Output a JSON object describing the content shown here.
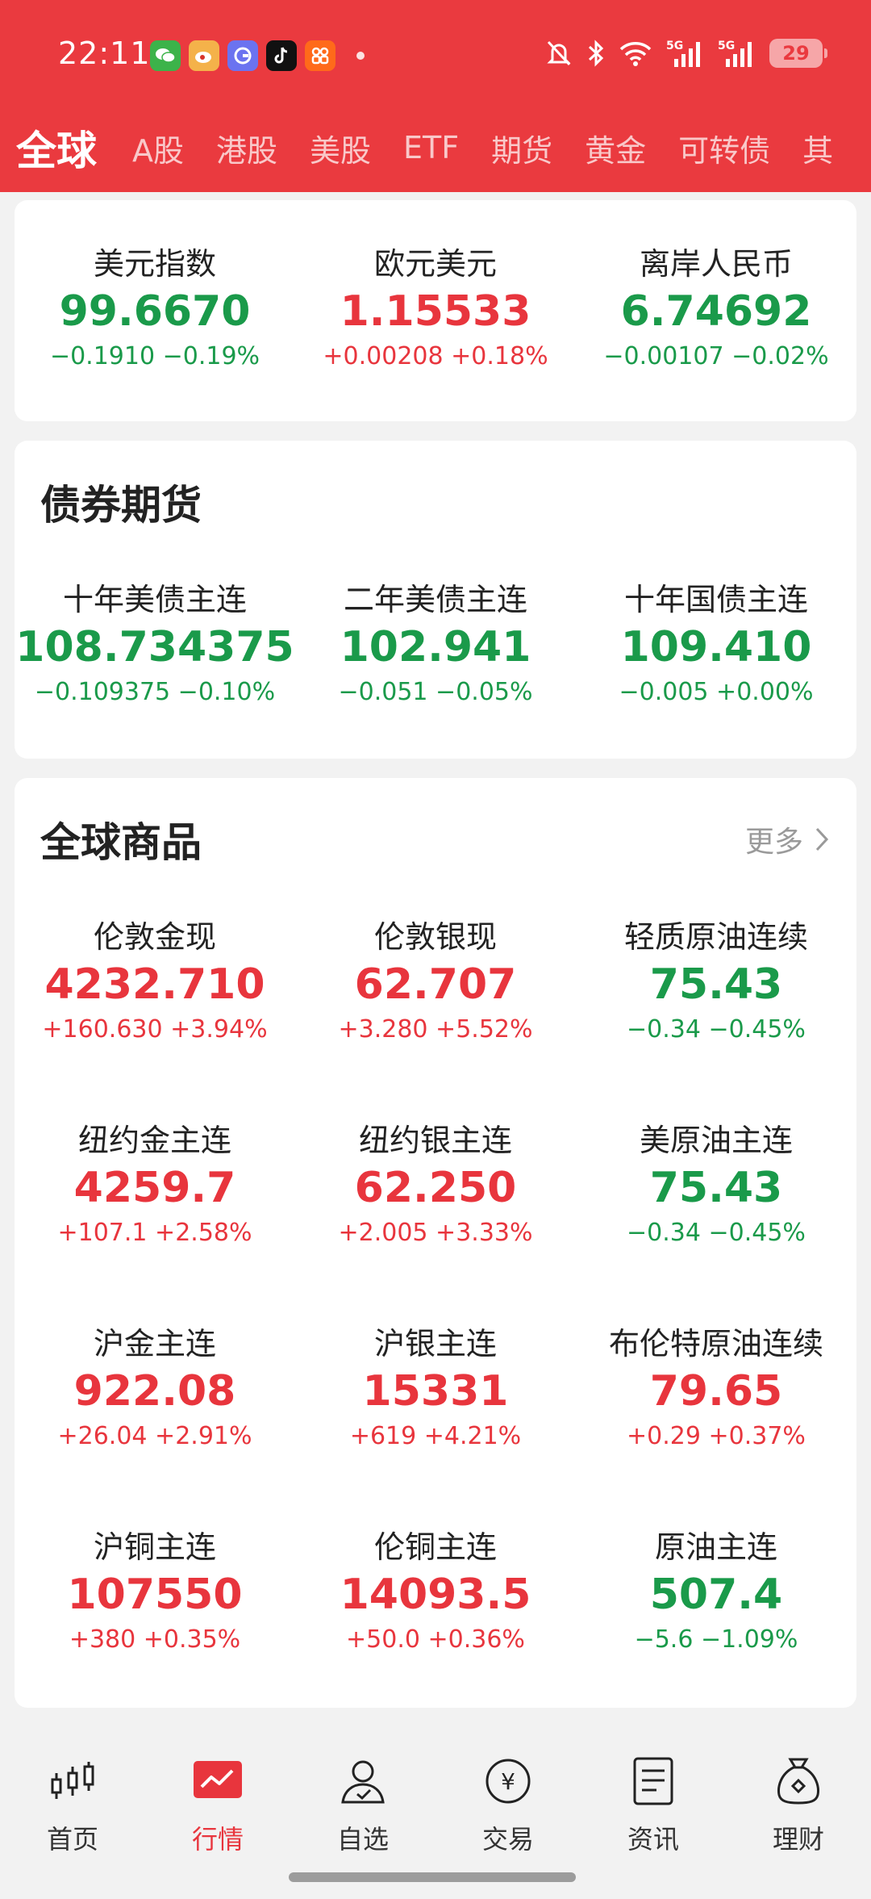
{
  "status_bar": {
    "time": "22:11",
    "battery": "29",
    "network_1": "5G",
    "network_2": "5G"
  },
  "tabs": [
    {
      "label": "全球",
      "active": true
    },
    {
      "label": "A股"
    },
    {
      "label": "港股"
    },
    {
      "label": "美股"
    },
    {
      "label": "ETF"
    },
    {
      "label": "期货"
    },
    {
      "label": "黄金"
    },
    {
      "label": "可转债"
    },
    {
      "label": "其"
    }
  ],
  "forex": {
    "items": [
      {
        "name": "美元指数",
        "price": "99.6670",
        "change": "−0.1910 −0.19%",
        "dir": "down"
      },
      {
        "name": "欧元美元",
        "price": "1.15533",
        "change": "+0.00208 +0.18%",
        "dir": "up"
      },
      {
        "name": "离岸人民币",
        "price": "6.74692",
        "change": "−0.00107 −0.02%",
        "dir": "down"
      }
    ]
  },
  "bonds": {
    "title": "债券期货",
    "items": [
      {
        "name": "十年美债主连",
        "price": "108.734375",
        "change": "−0.109375 −0.10%",
        "dir": "down"
      },
      {
        "name": "二年美债主连",
        "price": "102.941",
        "change": "−0.051 −0.05%",
        "dir": "down"
      },
      {
        "name": "十年国债主连",
        "price": "109.410",
        "change": "−0.005 +0.00%",
        "dir": "down"
      }
    ]
  },
  "commodities": {
    "title": "全球商品",
    "more": "更多",
    "items": [
      {
        "name": "伦敦金现",
        "price": "4232.710",
        "change": "+160.630 +3.94%",
        "dir": "up"
      },
      {
        "name": "伦敦银现",
        "price": "62.707",
        "change": "+3.280 +5.52%",
        "dir": "up"
      },
      {
        "name": "轻质原油连续",
        "price": "75.43",
        "change": "−0.34 −0.45%",
        "dir": "down"
      },
      {
        "name": "纽约金主连",
        "price": "4259.7",
        "change": "+107.1 +2.58%",
        "dir": "up"
      },
      {
        "name": "纽约银主连",
        "price": "62.250",
        "change": "+2.005 +3.33%",
        "dir": "up"
      },
      {
        "name": "美原油主连",
        "price": "75.43",
        "change": "−0.34 −0.45%",
        "dir": "down"
      },
      {
        "name": "沪金主连",
        "price": "922.08",
        "change": "+26.04 +2.91%",
        "dir": "up"
      },
      {
        "name": "沪银主连",
        "price": "15331",
        "change": "+619 +4.21%",
        "dir": "up"
      },
      {
        "name": "布伦特原油连续",
        "price": "79.65",
        "change": "+0.29 +0.37%",
        "dir": "up"
      },
      {
        "name": "沪铜主连",
        "price": "107550",
        "change": "+380 +0.35%",
        "dir": "up"
      },
      {
        "name": "伦铜主连",
        "price": "14093.5",
        "change": "+50.0 +0.36%",
        "dir": "up"
      },
      {
        "name": "原油主连",
        "price": "507.4",
        "change": "−5.6 −1.09%",
        "dir": "down"
      }
    ]
  },
  "bottom_nav": [
    {
      "label": "首页",
      "icon": "candlestick-icon"
    },
    {
      "label": "行情",
      "icon": "market-chart-icon",
      "active": true
    },
    {
      "label": "自选",
      "icon": "user-star-icon"
    },
    {
      "label": "交易",
      "icon": "yuan-coin-icon"
    },
    {
      "label": "资讯",
      "icon": "news-doc-icon"
    },
    {
      "label": "理财",
      "icon": "money-bag-icon"
    }
  ],
  "colors": {
    "up": "#e8353d",
    "down": "#1a9a4a",
    "header": "#ea3a3f"
  }
}
